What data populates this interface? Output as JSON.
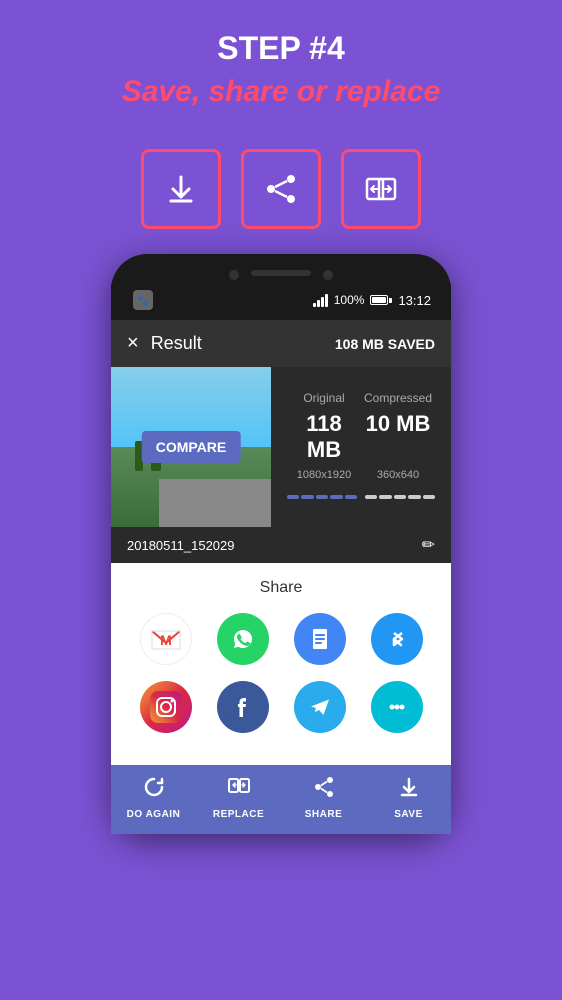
{
  "header": {
    "step_number": "STEP #4",
    "subtitle": "Save, share or replace"
  },
  "action_buttons": {
    "download_label": "download",
    "share_label": "share",
    "replace_label": "replace"
  },
  "phone": {
    "status_bar": {
      "battery_percent": "100%",
      "time": "13:12"
    },
    "app_bar": {
      "title": "Result",
      "saved_text": "108 MB SAVED",
      "close_label": "×"
    },
    "image": {
      "compare_button": "COMPARE",
      "filename": "20180511_152029"
    },
    "stats": {
      "original_label": "Original",
      "compressed_label": "Compressed",
      "original_size": "118 MB",
      "compressed_size": "10 MB",
      "original_dim": "1080x1920",
      "compressed_dim": "360x640"
    },
    "share_sheet": {
      "title": "Share",
      "apps": [
        {
          "name": "gmail",
          "label": "Gmail"
        },
        {
          "name": "whatsapp",
          "label": "WhatsApp"
        },
        {
          "name": "gdocs",
          "label": "Google Docs"
        },
        {
          "name": "bluetooth",
          "label": "Bluetooth"
        },
        {
          "name": "instagram",
          "label": "Instagram"
        },
        {
          "name": "facebook",
          "label": "Facebook"
        },
        {
          "name": "telegram",
          "label": "Telegram"
        },
        {
          "name": "messages",
          "label": "Messages"
        }
      ]
    },
    "toolbar": {
      "do_again": "DO AGAIN",
      "replace": "REPLACE",
      "share": "SHARE",
      "save": "SAVE"
    }
  }
}
